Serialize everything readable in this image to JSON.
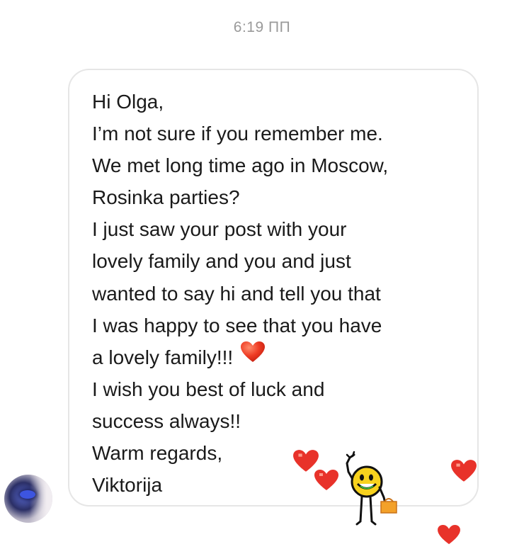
{
  "timestamp": "6:19 ПП",
  "message": {
    "lines": [
      "Hi Olga,",
      "I’m not sure if you remember me.",
      "We met long time ago in Moscow,",
      "Rosinka parties?",
      "I just saw your post with your",
      "lovely family and you and just",
      "wanted to say hi and tell you that",
      "I was happy to see that you have",
      "a lovely family!!!",
      "I wish you best of luck and",
      "success always!!",
      "Warm regards,",
      "Viktorija"
    ],
    "inline_emoji": "red-heart-icon"
  },
  "sender": {
    "avatar_icon": "avatar-photo"
  },
  "stickers": {
    "hearts_icon": "heart-icon",
    "character_icon": "smiley-character-icon"
  },
  "colors": {
    "heart": "#e8322a",
    "smiley": "#f7d21e",
    "timestamp": "#9a9a9a",
    "bubble_border": "#e6e6e6"
  }
}
